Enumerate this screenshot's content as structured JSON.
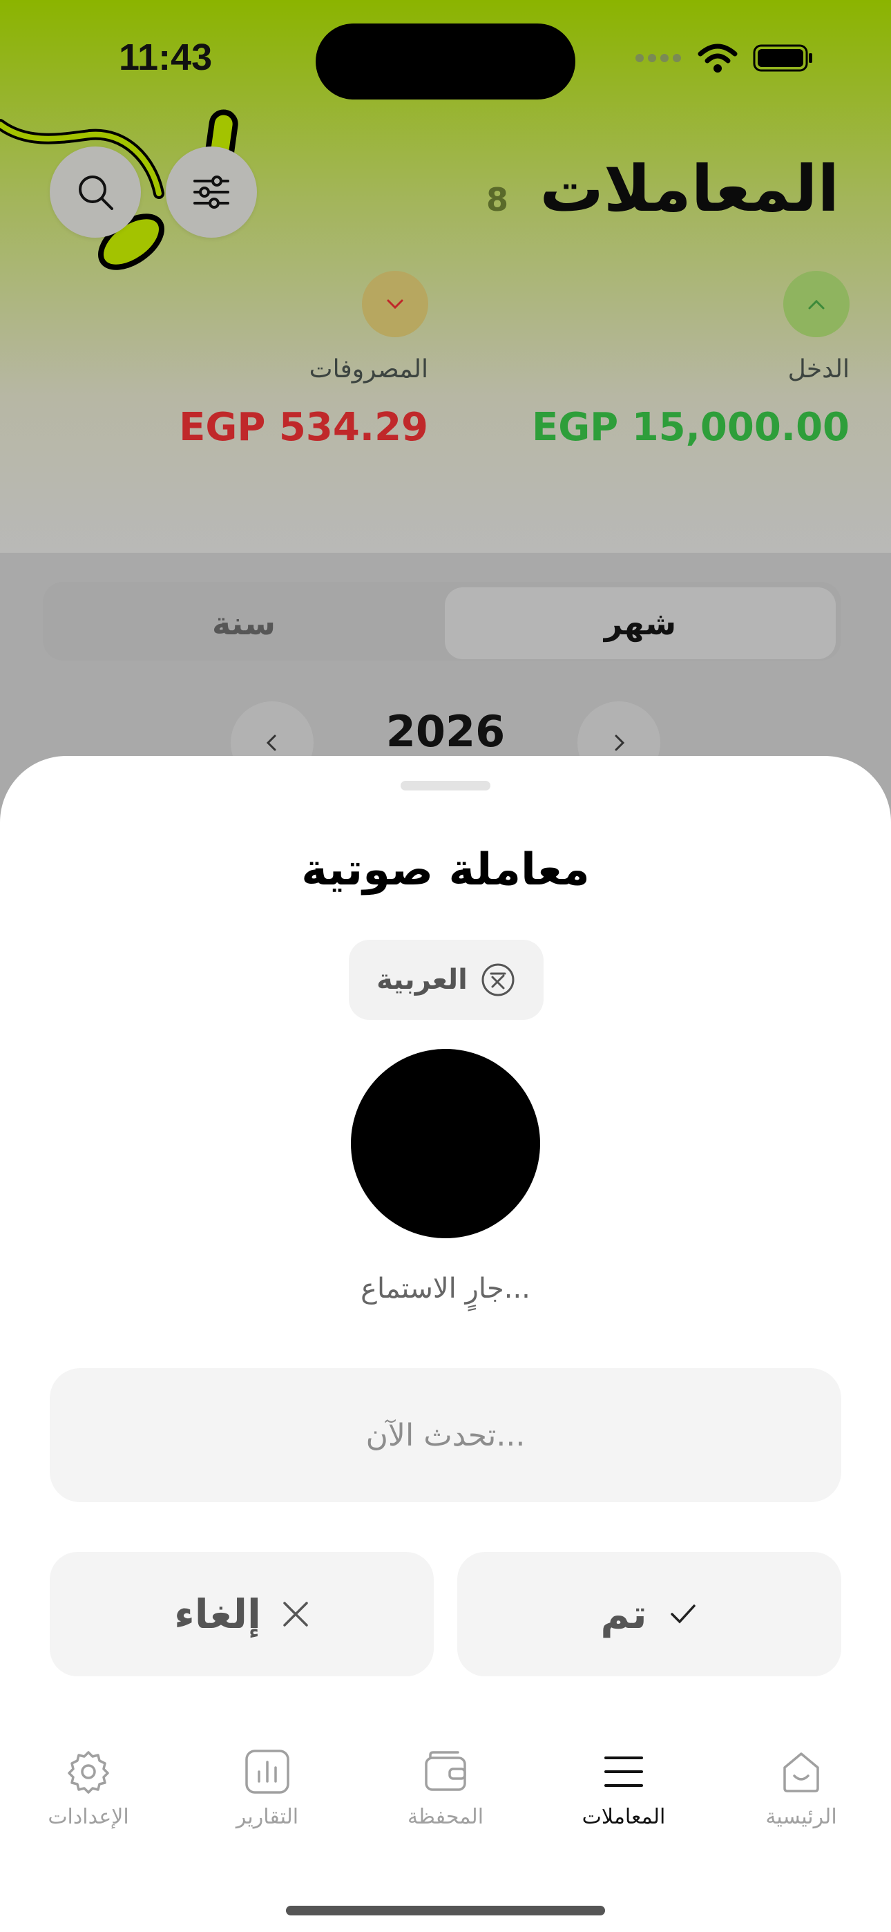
{
  "status_bar": {
    "time": "11:43"
  },
  "header": {
    "title": "المعاملات",
    "count": "8",
    "search_icon": "search-icon",
    "filter_icon": "sliders-icon"
  },
  "summary": {
    "income": {
      "label": "الدخل",
      "amount": "EGP 15,000.00",
      "color": "#2e9e3a"
    },
    "expenses": {
      "label": "المصروفات",
      "amount": "EGP 534.29",
      "color": "#c0282a"
    }
  },
  "period": {
    "tabs": [
      {
        "label": "شهر",
        "selected": true
      },
      {
        "label": "سنة",
        "selected": false
      }
    ],
    "year": "2026"
  },
  "sheet": {
    "title": "معاملة صوتية",
    "language_label": "العربية",
    "status_text": "جارٍ الاستماع...",
    "placeholder": "تحدث الآن...",
    "done_label": "تم",
    "cancel_label": "إلغاء"
  },
  "tabbar": {
    "items": [
      {
        "label": "الرئيسية",
        "icon": "home-icon",
        "active": false
      },
      {
        "label": "المعاملات",
        "icon": "list-icon",
        "active": true
      },
      {
        "label": "المحفظة",
        "icon": "wallet-icon",
        "active": false
      },
      {
        "label": "التقارير",
        "icon": "chart-icon",
        "active": false
      },
      {
        "label": "الإعدادات",
        "icon": "gear-icon",
        "active": false
      }
    ]
  },
  "colors": {
    "accent": "#8bb400",
    "income": "#2e9e3a",
    "expense": "#c0282a"
  }
}
